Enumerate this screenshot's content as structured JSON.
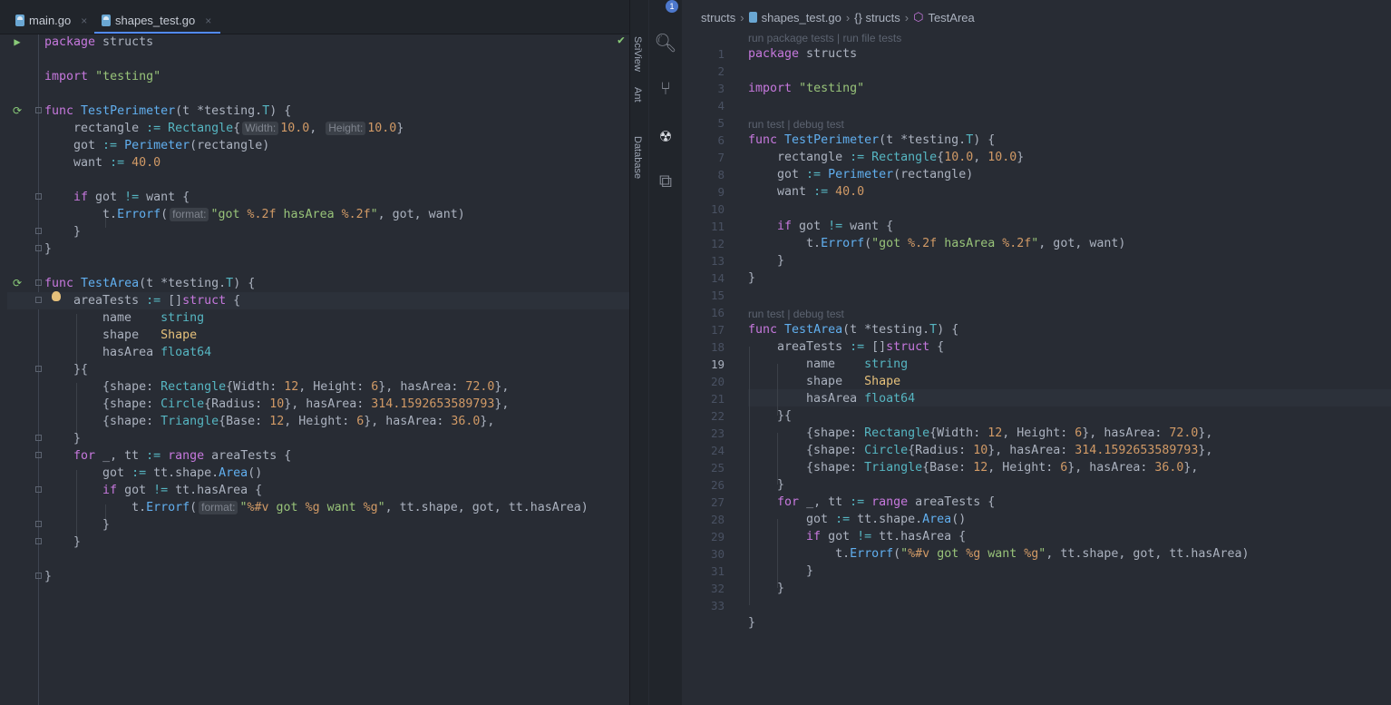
{
  "tabs": [
    {
      "label": "main.go",
      "active": false
    },
    {
      "label": "shapes_test.go",
      "active": true
    }
  ],
  "tool_windows": [
    "SciView",
    "Ant",
    "Database"
  ],
  "activity_badge": "1",
  "breadcrumb": [
    "structs",
    "shapes_test.go",
    "{} structs",
    "TestArea"
  ],
  "codelens": {
    "package": "run package tests | run file tests",
    "test1": "run test | debug test",
    "test2": "run test | debug test"
  },
  "inlay_hints": {
    "width": "Width:",
    "height": "Height:",
    "format": "format:"
  },
  "colors": {
    "keyword": "#c678dd",
    "string": "#98c379",
    "function": "#61afef",
    "type": "#56b6c2",
    "number": "#d19a66"
  },
  "line_numbers": [
    "1",
    "2",
    "3",
    "4",
    "5",
    "6",
    "7",
    "8",
    "9",
    "10",
    "11",
    "12",
    "13",
    "14",
    "15",
    "16",
    "17",
    "18",
    "19",
    "20",
    "21",
    "22",
    "23",
    "24",
    "25",
    "26",
    "27",
    "28",
    "29",
    "30",
    "31",
    "32",
    "33"
  ]
}
